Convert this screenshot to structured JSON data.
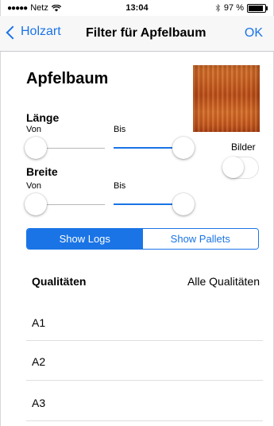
{
  "status_bar": {
    "carrier": "Netz",
    "time": "13:04",
    "battery": "97 %"
  },
  "nav": {
    "back_label": "Holzart",
    "title": "Filter für Apfelbaum",
    "ok_label": "OK"
  },
  "tree_name": "Apfelbaum",
  "laenge": {
    "label": "Länge",
    "from_label": "Von",
    "to_label": "Bis"
  },
  "breite": {
    "label": "Breite",
    "from_label": "Von",
    "to_label": "Bis"
  },
  "bilder": {
    "label": "Bilder",
    "on": false
  },
  "segment": {
    "options": [
      "Show Logs",
      "Show Pallets"
    ],
    "selected": "Show Logs"
  },
  "qualitaeten": {
    "label": "Qualitäten",
    "value": "Alle Qualitäten",
    "items": [
      "A1",
      "A2",
      "A3"
    ]
  },
  "colors": {
    "accent": "#1a74e6",
    "wood": "#c85a22"
  }
}
